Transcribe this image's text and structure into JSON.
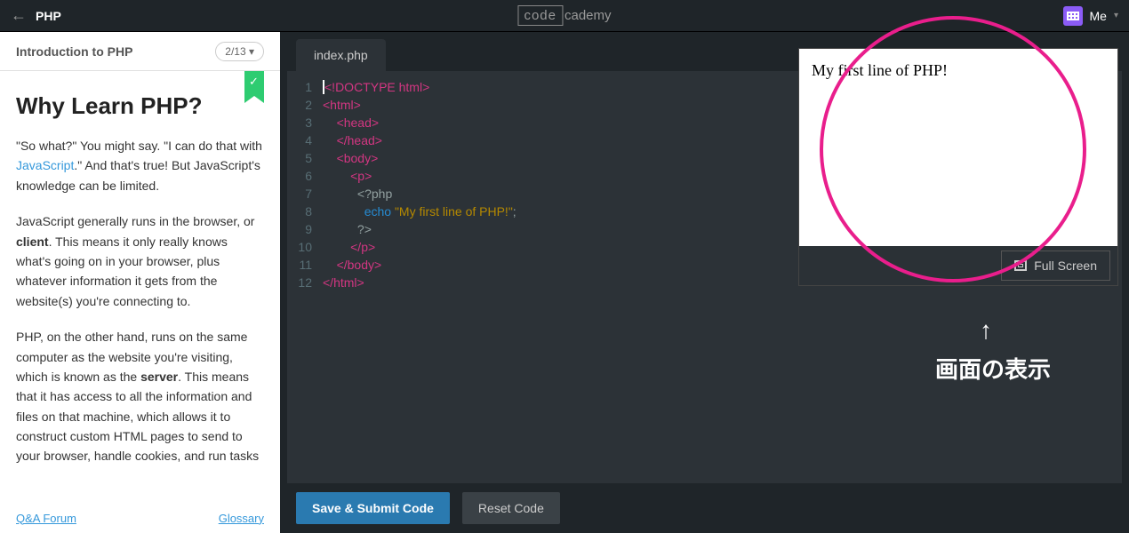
{
  "topbar": {
    "course_name": "PHP",
    "logo_left": "code",
    "logo_right": "cademy",
    "me_label": "Me"
  },
  "sidebar": {
    "section_title": "Introduction to PHP",
    "progress_label": "2/13 ▾",
    "heading": "Why Learn PHP?",
    "para1_a": "\"So what?\" You might say. \"I can do that with ",
    "para1_link": "JavaScript",
    "para1_b": ".\" And that's true! But JavaScript's knowledge can be limited.",
    "para2_a": "JavaScript generally runs in the browser, or ",
    "para2_strong": "client",
    "para2_b": ". This means it only really knows what's going on in your browser, plus whatever information it gets from the website(s) you're connecting to.",
    "para3_a": "PHP, on the other hand, runs on the same computer as the website you're visiting, which is known as the ",
    "para3_strong": "server",
    "para3_b": ". This means that it has access to all the information and files on that machine, which allows it to construct custom HTML pages to send to your browser, handle cookies, and run tasks",
    "footer_qa": "Q&A Forum",
    "footer_glossary": "Glossary"
  },
  "editor": {
    "tab_name": "index.php",
    "lines": [
      {
        "n": "1",
        "indent": "",
        "cursor": true,
        "tag": "<!DOCTYPE html>"
      },
      {
        "n": "2",
        "indent": "",
        "tag": "<html>"
      },
      {
        "n": "3",
        "indent": "    ",
        "tag": "<head>"
      },
      {
        "n": "4",
        "indent": "    ",
        "tag": "</head>"
      },
      {
        "n": "5",
        "indent": "    ",
        "tag": "<body>"
      },
      {
        "n": "6",
        "indent": "        ",
        "tag": "<p>"
      },
      {
        "n": "7",
        "indent": "          ",
        "php_open": "<?php"
      },
      {
        "n": "8",
        "indent": "            ",
        "kw": "echo",
        "str": "\"My first line of PHP!\"",
        "semi": ";"
      },
      {
        "n": "9",
        "indent": "          ",
        "php_close": "?>"
      },
      {
        "n": "10",
        "indent": "        ",
        "tag": "</p>"
      },
      {
        "n": "11",
        "indent": "    ",
        "tag": "</body>"
      },
      {
        "n": "12",
        "indent": "",
        "tag": "</html>"
      }
    ],
    "save_label": "Save & Submit Code",
    "reset_label": "Reset Code"
  },
  "preview": {
    "output_text": "My first line of PHP!",
    "fullscreen_label": "Full Screen"
  },
  "annotation": {
    "arrow": "↑",
    "caption": "画面の表示"
  }
}
